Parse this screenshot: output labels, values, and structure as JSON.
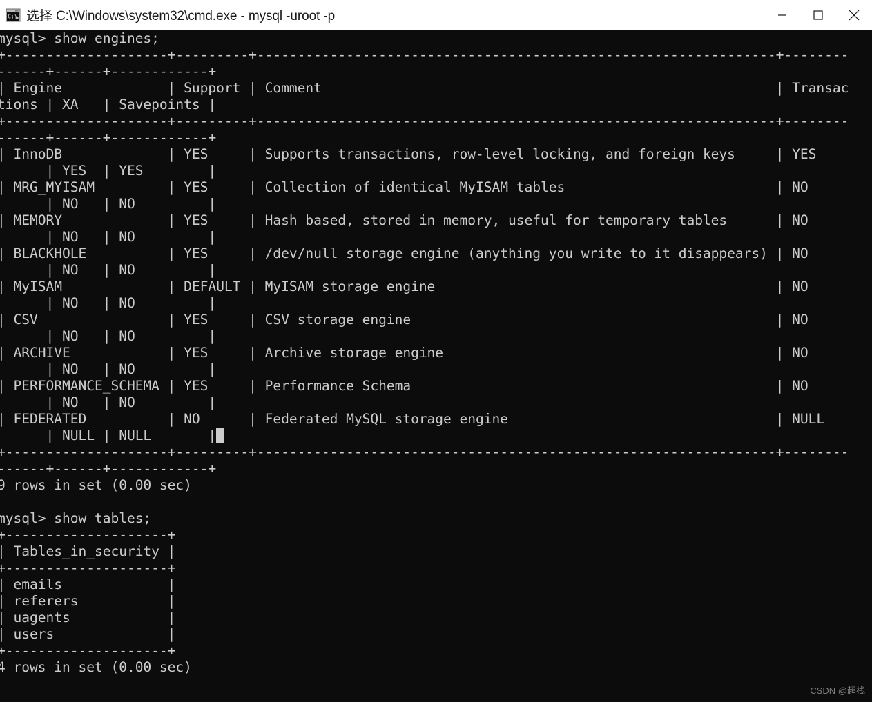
{
  "window": {
    "title": "选择 C:\\Windows\\system32\\cmd.exe - mysql  -uroot -p",
    "icon": "cmd-console-icon",
    "titlebar_bg": "#ffffff",
    "console_bg": "#0c0c0c",
    "console_fg": "#cccccc",
    "controls": {
      "minimize_label": "—",
      "maximize_label": "□",
      "close_label": "✕"
    }
  },
  "terminal": {
    "prompt": "mysql>",
    "commands": [
      "show engines;",
      "show tables;"
    ],
    "engines_table": {
      "columns": [
        "Engine",
        "Support",
        "Comment",
        "Transactions",
        "XA",
        "Savepoints"
      ],
      "rows": [
        {
          "Engine": "InnoDB",
          "Support": "YES",
          "Comment": "Supports transactions, row-level locking, and foreign keys",
          "Transactions": "YES",
          "XA": "YES",
          "Savepoints": "YES"
        },
        {
          "Engine": "MRG_MYISAM",
          "Support": "YES",
          "Comment": "Collection of identical MyISAM tables",
          "Transactions": "NO",
          "XA": "NO",
          "Savepoints": "NO"
        },
        {
          "Engine": "MEMORY",
          "Support": "YES",
          "Comment": "Hash based, stored in memory, useful for temporary tables",
          "Transactions": "NO",
          "XA": "NO",
          "Savepoints": "NO"
        },
        {
          "Engine": "BLACKHOLE",
          "Support": "YES",
          "Comment": "/dev/null storage engine (anything you write to it disappears)",
          "Transactions": "NO",
          "XA": "NO",
          "Savepoints": "NO"
        },
        {
          "Engine": "MyISAM",
          "Support": "DEFAULT",
          "Comment": "MyISAM storage engine",
          "Transactions": "NO",
          "XA": "NO",
          "Savepoints": "NO"
        },
        {
          "Engine": "CSV",
          "Support": "YES",
          "Comment": "CSV storage engine",
          "Transactions": "NO",
          "XA": "NO",
          "Savepoints": "NO"
        },
        {
          "Engine": "ARCHIVE",
          "Support": "YES",
          "Comment": "Archive storage engine",
          "Transactions": "NO",
          "XA": "NO",
          "Savepoints": "NO"
        },
        {
          "Engine": "PERFORMANCE_SCHEMA",
          "Support": "YES",
          "Comment": "Performance Schema",
          "Transactions": "NO",
          "XA": "NO",
          "Savepoints": "NO"
        },
        {
          "Engine": "FEDERATED",
          "Support": "NO",
          "Comment": "Federated MySQL storage engine",
          "Transactions": "NULL",
          "XA": "NULL",
          "Savepoints": "NULL"
        }
      ],
      "result_line": "9 rows in set (0.00 sec)"
    },
    "tables_table": {
      "column": "Tables_in_security",
      "rows": [
        "emails",
        "referers",
        "uagents",
        "users"
      ],
      "result_line": "4 rows in set (0.00 sec)"
    },
    "cursor": {
      "char": "F",
      "line_index": 24,
      "column_index": 33
    },
    "lines": [
      "mysql> show engines;",
      "+--------------------+---------+----------------------------------------------------------------+--------",
      "------+------+------------+",
      "| Engine             | Support | Comment                                                        | Transac",
      "tions | XA   | Savepoints |",
      "+--------------------+---------+----------------------------------------------------------------+--------",
      "------+------+------------+",
      "| InnoDB             | YES     | Supports transactions, row-level locking, and foreign keys     | YES",
      "      | YES  | YES        |",
      "| MRG_MYISAM         | YES     | Collection of identical MyISAM tables                          | NO",
      "      | NO   | NO         |",
      "| MEMORY             | YES     | Hash based, stored in memory, useful for temporary tables      | NO",
      "      | NO   | NO         |",
      "| BLACKHOLE          | YES     | /dev/null storage engine (anything you write to it disappears) | NO",
      "      | NO   | NO         |",
      "| MyISAM             | DEFAULT | MyISAM storage engine                                          | NO",
      "      | NO   | NO         |",
      "| CSV                | YES     | CSV storage engine                                             | NO",
      "      | NO   | NO         |",
      "| ARCHIVE            | YES     | Archive storage engine                                         | NO",
      "      | NO   | NO         |",
      "| PERFORMANCE_SCHEMA | YES     | Performance Schema                                             | NO",
      "      | NO   | NO         |",
      "| FEDERATED          | NO      | Federated MySQL storage engine                                 | NULL",
      "      | NULL | NULL       |",
      "+--------------------+---------+----------------------------------------------------------------+--------",
      "------+------+------------+",
      "9 rows in set (0.00 sec)",
      "",
      "mysql> show tables;",
      "+--------------------+",
      "| Tables_in_security |",
      "+--------------------+",
      "| emails             |",
      "| referers           |",
      "| uagents            |",
      "| users              |",
      "+--------------------+",
      "4 rows in set (0.00 sec)"
    ]
  },
  "watermark": {
    "text": "CSDN @超栈"
  }
}
